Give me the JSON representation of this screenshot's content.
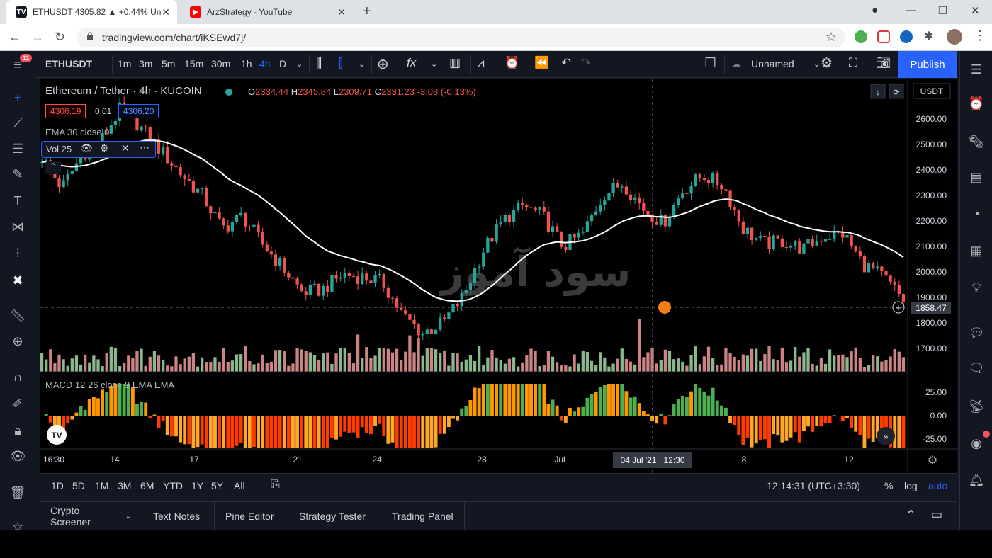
{
  "browser": {
    "tabs": [
      {
        "title": "ETHUSDT 4305.82 ▲ +0.44% Un",
        "icon": "tradingview-icon"
      },
      {
        "title": "ArzStrategy - YouTube",
        "icon": "youtube-icon"
      }
    ],
    "url": "tradingview.com/chart/iKSEwd7j/"
  },
  "toolbar": {
    "symbol": "ETHUSDT",
    "intervals": [
      "1m",
      "3m",
      "5m",
      "15m",
      "30m",
      "1h",
      "4h",
      "D"
    ],
    "active_interval": "4h",
    "layout_name": "Unnamed",
    "publish_label": "Publish",
    "notif_count": "11"
  },
  "legend": {
    "title": "Ethereum / Tether · 4h · KUCOIN",
    "o_label": "O",
    "o": "2334.44",
    "h_label": "H",
    "h": "2345.84",
    "l_label": "L",
    "l": "2309.71",
    "c_label": "C",
    "c": "2331.23",
    "change": "-3.08 (-0.13%)",
    "sell_price": "4306.19",
    "spread": "0.01",
    "buy_price": "4306.20",
    "ema_label": "EMA 30 close 0",
    "vol_label": "Vol 25",
    "macd_label": "MACD 12 26 close 9 EMA EMA",
    "currency": "USDT"
  },
  "price_axis": [
    "2600.00",
    "2500.00",
    "2400.00",
    "2300.00",
    "2200.00",
    "2100.00",
    "2000.00",
    "1900.00",
    "1800.00",
    "1700.00"
  ],
  "crosshair_price": "1858.47",
  "macd_axis": [
    "25.00",
    "0.00",
    "-25.00"
  ],
  "time_axis": [
    "16:30",
    "14",
    "17",
    "21",
    "24",
    "28",
    "Jul",
    "8",
    "12"
  ],
  "crosshair_time": "04 Jul '21   12:30",
  "watermark": "سود آموز",
  "ranges": [
    "1D",
    "5D",
    "1M",
    "3M",
    "6M",
    "YTD",
    "1Y",
    "5Y",
    "All"
  ],
  "clock": "12:14:31 (UTC+3:30)",
  "scale_opts": [
    "%",
    "log",
    "auto"
  ],
  "panels": [
    "Crypto Screener",
    "Text Notes",
    "Pine Editor",
    "Strategy Tester",
    "Trading Panel"
  ],
  "colors": {
    "up": "#26a69a",
    "down": "#ef5350",
    "accent": "#2962ff",
    "ema": "#ffffff"
  },
  "chart_data": {
    "type": "candlestick",
    "title": "Ethereum / Tether · 4h · KUCOIN",
    "x_range": [
      "2021-06-11",
      "2021-07-14"
    ],
    "ylim": [
      1650,
      2650
    ],
    "approx_closes": [
      2450,
      2330,
      2460,
      2520,
      2650,
      2560,
      2470,
      2380,
      2300,
      2170,
      2220,
      2110,
      2020,
      1920,
      1930,
      1990,
      1980,
      1960,
      1830,
      1760,
      1800,
      1900,
      2080,
      2200,
      2260,
      2220,
      2100,
      2150,
      2300,
      2350,
      2250,
      2190,
      2320,
      2380,
      2340,
      2170,
      2110,
      2120,
      2090,
      2140,
      2150,
      2030,
      1980,
      1890
    ],
    "ema_period": 30,
    "macd_settings": "12 26 close 9"
  }
}
